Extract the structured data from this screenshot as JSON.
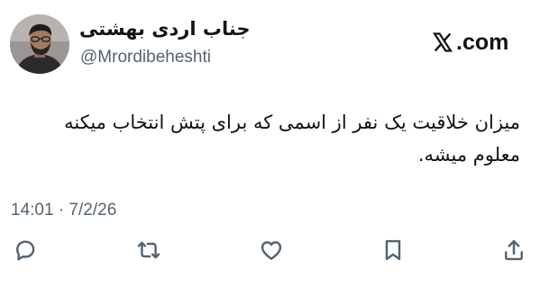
{
  "author": {
    "display_name": "جناب اردی بهشتی",
    "handle": "@Mrordibeheshti"
  },
  "brand": {
    "icon": "x-logo-icon",
    "text": ".com"
  },
  "tweet": {
    "text": "میزان خلاقیت یک نفر از اسمی که برای پتش انتخاب میکنه\nمعلوم میشه.",
    "timestamp": "14:01 · 7/2/26"
  },
  "actions": [
    {
      "icon": "reply-icon"
    },
    {
      "icon": "retweet-icon"
    },
    {
      "icon": "heart-icon"
    },
    {
      "icon": "bookmark-icon"
    },
    {
      "icon": "share-icon"
    }
  ],
  "colors": {
    "text": "#0f1419",
    "secondary": "#536471",
    "background": "#ffffff"
  }
}
